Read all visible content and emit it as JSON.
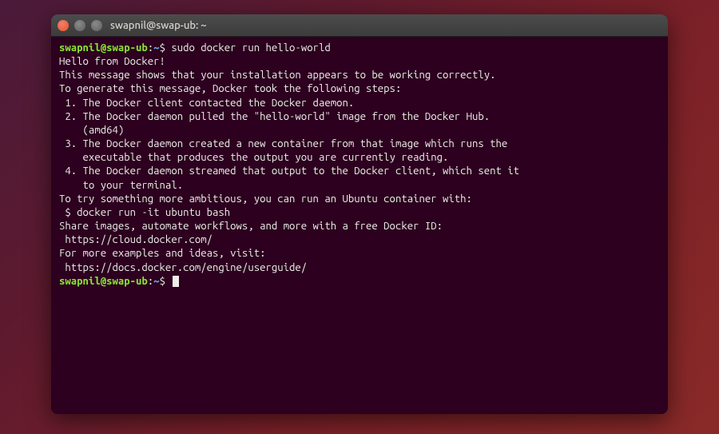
{
  "window": {
    "title": "swapnil@swap-ub: ~"
  },
  "prompt": {
    "user_host": "swapnil@swap-ub",
    "separator": ":",
    "path": "~",
    "symbol": "$"
  },
  "command": "sudo docker run hello-world",
  "output_lines": [
    "",
    "Hello from Docker!",
    "This message shows that your installation appears to be working correctly.",
    "",
    "To generate this message, Docker took the following steps:",
    " 1. The Docker client contacted the Docker daemon.",
    " 2. The Docker daemon pulled the \"hello-world\" image from the Docker Hub.",
    "    (amd64)",
    " 3. The Docker daemon created a new container from that image which runs the",
    "    executable that produces the output you are currently reading.",
    " 4. The Docker daemon streamed that output to the Docker client, which sent it",
    "    to your terminal.",
    "",
    "To try something more ambitious, you can run an Ubuntu container with:",
    " $ docker run -it ubuntu bash",
    "",
    "Share images, automate workflows, and more with a free Docker ID:",
    " https://cloud.docker.com/",
    "",
    "For more examples and ideas, visit:",
    " https://docs.docker.com/engine/userguide/",
    ""
  ]
}
